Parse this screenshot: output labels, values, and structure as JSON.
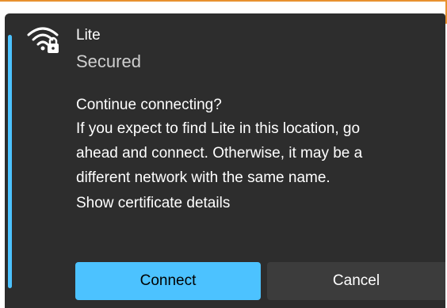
{
  "network": {
    "name": "Lite",
    "status": "Secured",
    "icon": "wifi-lock-icon"
  },
  "message": {
    "line1": "Continue connecting?",
    "line2": "If you expect to find Lite in this location, go",
    "line3": "ahead and connect. Otherwise, it may be a",
    "line4": "different network with the same name.",
    "cert_link": "Show certificate details"
  },
  "buttons": {
    "connect_label": "Connect",
    "cancel_label": "Cancel"
  },
  "colors": {
    "accent": "#4cc2ff",
    "panel_bg": "#2d2d2d",
    "window_edge": "#e8912f"
  }
}
